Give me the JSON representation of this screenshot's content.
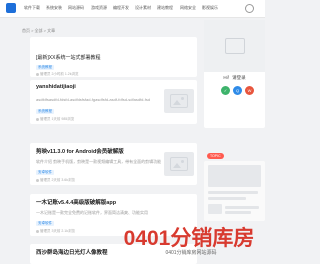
{
  "nav": {
    "items": [
      "软件下载",
      "系统安装",
      "网站源码",
      "游戏资源",
      "编程开发",
      "设计素材",
      "建站教程",
      "网络安全",
      "影视娱乐"
    ]
  },
  "breadcrumb": "首页 > 全部 > 文章",
  "posts": [
    {
      "title": "[最新]XX系统一站式部署教程",
      "tag": "系统教程",
      "meta": "管理员 2小时前 1.2k浏览"
    },
    {
      "title": "yanshidatijiaoji",
      "excerpt": "asdfdfsasdfd-fdsfd-asdfdsfsfad-fgasdfsfd-asdf-fdfsd-sdfasdfd-fsd",
      "tag": "系统教程",
      "meta": "管理员 1天前 985浏览"
    },
    {
      "title": "剪映v11.3.0 for Android会员破解版",
      "excerpt": "软件介绍 剪映手机版，剪映是一款视频编辑工具，带有全面的剪辑功能",
      "tag": "安卓软件",
      "meta": "管理员 2天前 3.6k浏览"
    },
    {
      "title": "一木记账v5.4.4高级版破解版app",
      "excerpt": "一木记账是一款完全免费的记账软件，界面简洁清爽、功能实用",
      "tag": "安卓软件",
      "meta": "管理员 3天前 2.1k浏览"
    },
    {
      "title": "西沙群岛海边日光灯人像教程"
    }
  ],
  "sidebar": {
    "login_text": "Hi！请登录",
    "topic_label": "TOPIC"
  },
  "watermark": {
    "big": "0401分销库房",
    "small": "0401分销库房网站源码"
  },
  "colors": {
    "accent": "#1e6fd9",
    "tag": "#2e8be8",
    "hot": "#ff5a4e"
  }
}
